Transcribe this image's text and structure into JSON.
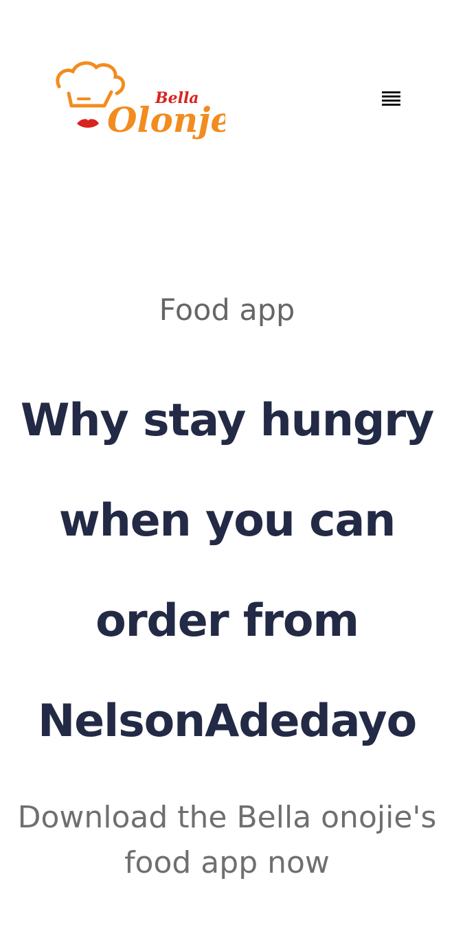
{
  "header": {
    "logo_top_text": "Bella",
    "logo_main_text": "Olonje",
    "menu_icon": "hamburger-menu-icon",
    "logo_icon": "chef-hat-icon"
  },
  "hero": {
    "eyebrow": "Food app",
    "headline_lines": [
      "Why stay hungry",
      "when you can",
      "order from",
      "NelsonAdedayo"
    ],
    "subtext_lines": [
      "Download the Bella onojie's",
      "food app now"
    ]
  },
  "colors": {
    "brand_orange": "#f28c1e",
    "brand_red": "#d8231f",
    "headline": "#232a45",
    "muted_text": "#666666"
  }
}
